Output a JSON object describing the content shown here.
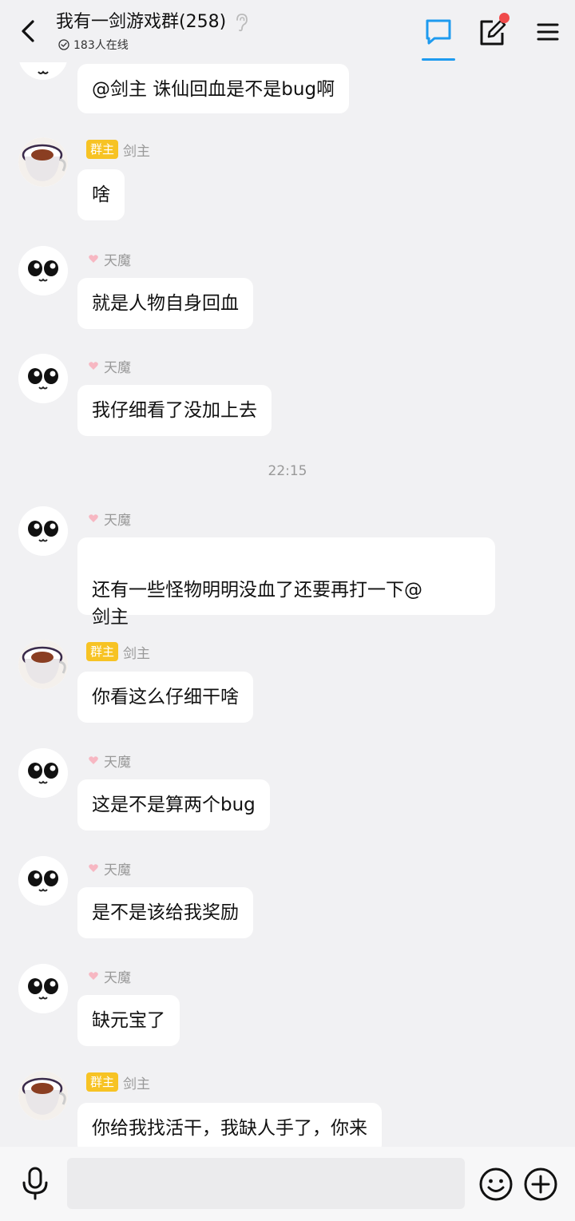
{
  "header": {
    "title": "我有一剑游戏群(258)",
    "online": "183人在线"
  },
  "messages": [
    {
      "sender": "",
      "role": "",
      "text": "@剑主 诛仙回血是不是bug啊"
    },
    {
      "sender": "剑主",
      "role": "群主",
      "text": "啥"
    },
    {
      "sender": "天魔",
      "role": "",
      "text": "就是人物自身回血"
    },
    {
      "sender": "天魔",
      "role": "",
      "text": "我仔细看了没加上去"
    },
    {
      "sender": "天魔",
      "role": "",
      "text": "还有一些怪物明明没血了还要再打一下@\n剑主"
    },
    {
      "sender": "剑主",
      "role": "群主",
      "text": "你看这么仔细干啥"
    },
    {
      "sender": "天魔",
      "role": "",
      "text": "这是不是算两个bug"
    },
    {
      "sender": "天魔",
      "role": "",
      "text": "是不是该给我奖励"
    },
    {
      "sender": "天魔",
      "role": "",
      "text": "缺元宝了"
    },
    {
      "sender": "剑主",
      "role": "群主",
      "text": "你给我找活干，我缺人手了，你来"
    }
  ],
  "timestamp": "22:15",
  "colors": {
    "accent": "#1e9bef",
    "owner_badge": "#f7c324",
    "notification_dot": "#f04a4a",
    "background": "#f1f1f3"
  },
  "icons": {
    "back": "chevron-left-icon",
    "ear": "ear-icon",
    "online": "check-circle-icon",
    "chat_tab": "chat-bubble-icon",
    "edit_tab": "edit-icon",
    "menu": "hamburger-menu-icon",
    "mic": "microphone-icon",
    "emoji": "smiley-icon",
    "plus": "plus-circle-icon"
  }
}
